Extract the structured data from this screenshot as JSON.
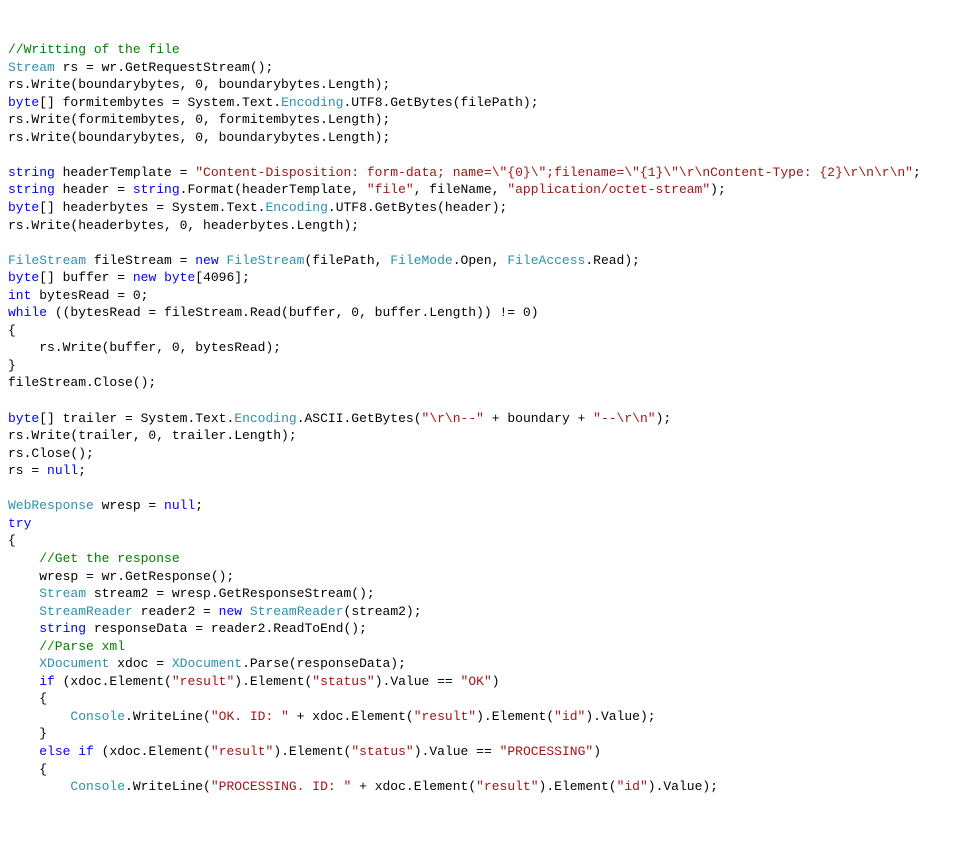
{
  "c": {
    "a": "//Writting of the file",
    "b": "Stream",
    "c": " rs = wr.GetRequestStream();",
    "d": "rs.Write(boundarybytes, 0, boundarybytes.Length);",
    "e": "byte",
    "f": "[] formitembytes = System.Text.",
    "g": "Encoding",
    "h": ".UTF8.GetBytes(filePath);",
    "i": "rs.Write(formitembytes, 0, formitembytes.Length);",
    "j": "rs.Write(boundarybytes, 0, boundarybytes.Length);",
    "k": "string",
    "l": " headerTemplate = ",
    "m": "\"Content-Disposition: form-data; name=\\\"{0}\\\";filename=\\\"{1}\\\"\\r\\nContent-Type: {2}\\r\\n\\r\\n\"",
    "n": " header = ",
    "o": ".Format(headerTemplate, ",
    "p": "\"file\"",
    "q": ", fileName, ",
    "r": "\"application/octet-stream\"",
    "s": "[] headerbytes = System.Text.",
    "t": ".UTF8.GetBytes(header);",
    "u": "rs.Write(headerbytes, 0, headerbytes.Length);",
    "v": "FileStream",
    "w": " fileStream = ",
    "x": "new",
    "y": "(filePath, ",
    "z": "FileMode",
    "aa": ".Open, ",
    "ab": "FileAccess",
    "ac": ".Read);",
    "ad": "[] buffer = ",
    "ae": "[4096];",
    "af": "int",
    "ag": " bytesRead = 0;",
    "ah": "while",
    "ai": " ((bytesRead = fileStream.Read(buffer, 0, buffer.Length)) != 0)",
    "aj": "{",
    "ak": "    rs.Write(buffer, 0, bytesRead);",
    "al": "}",
    "am": "fileStream.Close();",
    "an": "[] trailer = System.Text.",
    "ao": ".ASCII.GetBytes(",
    "ap": "\"\\r\\n--\"",
    "aq": " + boundary + ",
    "ar": "\"--\\r\\n\"",
    "as": "rs.Write(trailer, 0, trailer.Length);",
    "at": "rs.Close();",
    "au": "rs = ",
    "av": "null",
    "aw": "WebResponse",
    "ax": " wresp = ",
    "ay": "try",
    "az": "    //Get the response",
    "ba": "    wresp = wr.GetResponse();",
    "bb": " stream2 = wresp.GetResponseStream();",
    "bc": "StreamReader",
    "bd": " reader2 = ",
    "be": "(stream2);",
    "bf": " responseData = reader2.ReadToEnd();",
    "bg": "    //Parse xml",
    "bh": "XDocument",
    "bi": " xdoc = ",
    "bj": ".Parse(responseData);",
    "bk": "if",
    "bl": " (xdoc.Element(",
    "bm": "\"result\"",
    "bn": ").Element(",
    "bo": "\"status\"",
    "bp": ").Value == ",
    "bq": "\"OK\"",
    "br": "    {",
    "bs": "Console",
    "bt": ".WriteLine(",
    "bu": "\"OK. ID: \"",
    "bv": " + xdoc.Element(",
    "bw": "\"id\"",
    "bx": ").Value);",
    "by": "    }",
    "bz": "else",
    "ca": "\"PROCESSING\"",
    "cb": "\"PROCESSING. ID: \"",
    "cc": ";",
    "cd": ");",
    "ce": ")",
    "cf": " ",
    "cg": "    ",
    "ch": "        "
  }
}
